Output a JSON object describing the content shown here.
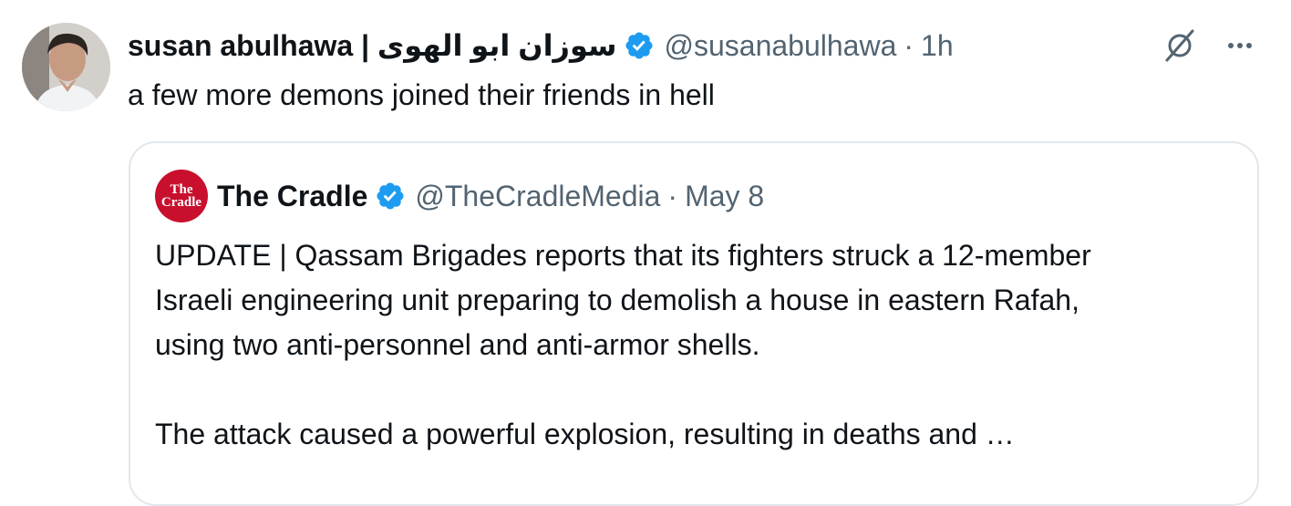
{
  "tweet": {
    "author_name": "susan abulhawa | سوزان ابو الهوى",
    "handle": "@susanabulhawa",
    "separator": "·",
    "time": "1h",
    "text": "a few more demons joined their friends in hell"
  },
  "quoted_tweet": {
    "avatar_text": "The Cradle",
    "author_name": "The Cradle",
    "handle": "@TheCradleMedia",
    "separator": "·",
    "date": "May 8",
    "text": "UPDATE | Qassam Brigades reports that its fighters struck a 12-member\nIsraeli engineering unit preparing to demolish a house in eastern Rafah,\nusing two anti-personnel and anti-armor shells.\n\nThe attack caused a powerful explosion, resulting in deaths and …"
  },
  "icons": {
    "verified": "verified-badge-icon",
    "grok": "grok-icon",
    "more": "more-icon"
  },
  "colors": {
    "verified_blue": "#1d9bf0",
    "muted_text": "#536471",
    "cradle_red": "#c8102e"
  }
}
